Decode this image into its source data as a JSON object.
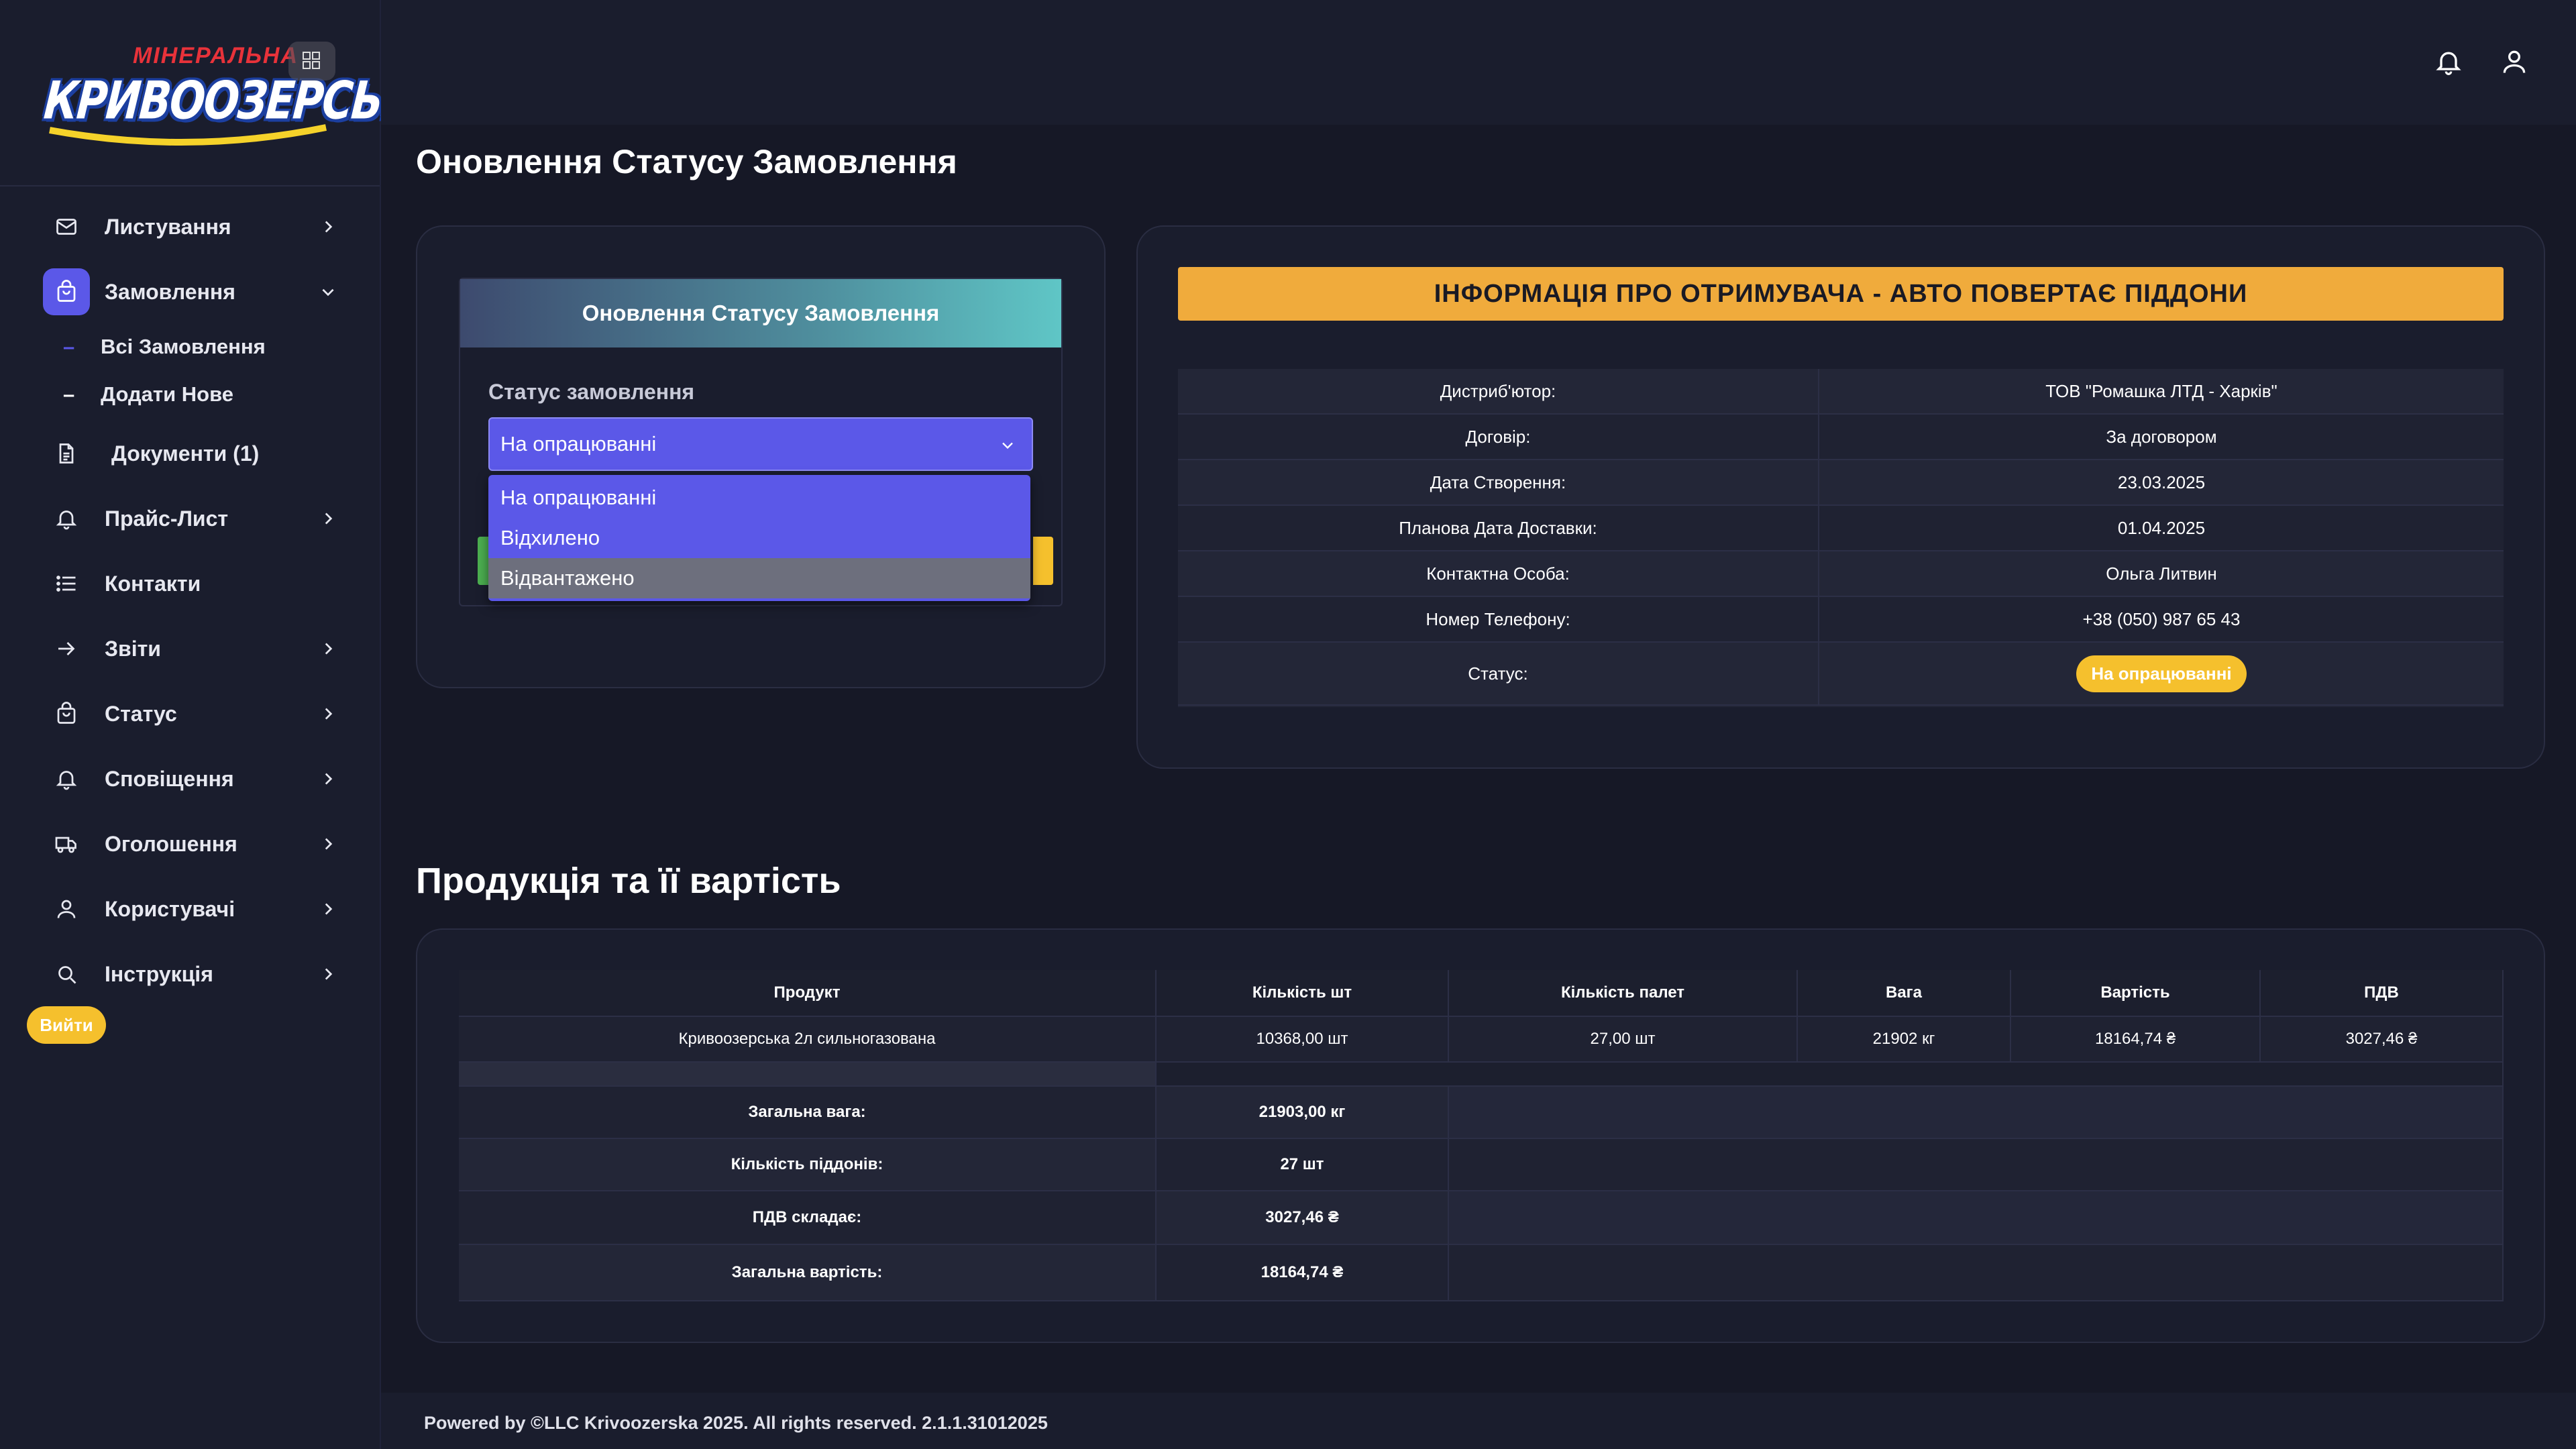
{
  "logo": {
    "top_text": "МІНЕРАЛЬНА",
    "main_text": "КРИВООЗЕРСЬКА"
  },
  "sidebar": {
    "items": [
      {
        "label": "Листування",
        "icon": "mail-icon",
        "chevron": "right"
      },
      {
        "label": "Замовлення",
        "icon": "shopping-bag-icon",
        "chevron": "down",
        "active": true
      },
      {
        "label": "Документи (1)",
        "icon": "document-icon"
      },
      {
        "label": "Прайс-Лист",
        "icon": "bell-icon",
        "chevron": "right"
      },
      {
        "label": "Контакти",
        "icon": "list-icon"
      },
      {
        "label": "Звіти",
        "icon": "arrow-right-icon",
        "chevron": "right"
      },
      {
        "label": "Статус",
        "icon": "shopping-bag-icon",
        "chevron": "right"
      },
      {
        "label": "Сповіщення",
        "icon": "bell-icon",
        "chevron": "right"
      },
      {
        "label": "Оголошення",
        "icon": "truck-icon",
        "chevron": "right"
      },
      {
        "label": "Користувачі",
        "icon": "user-icon",
        "chevron": "right"
      },
      {
        "label": "Інструкція",
        "icon": "search-icon",
        "chevron": "right"
      }
    ],
    "sub_items": [
      {
        "label": "Всі Замовлення"
      },
      {
        "label": "Додати Нове"
      }
    ],
    "logout_label": "Вийти"
  },
  "header": {
    "page_title": "Оновлення Статусу Замовлення"
  },
  "status_form": {
    "panel_title": "Оновлення Статусу Замовлення",
    "field_label": "Статус замовлення",
    "selected": "На опрацюванні",
    "options": [
      "На опрацюванні",
      "Відхилено",
      "Відвантажено"
    ],
    "hovered_option": "Відвантажено"
  },
  "recipient": {
    "banner": "ІНФОРМАЦІЯ ПРО ОТРИМУВАЧА - АВТО ПОВЕРТАЄ ПІДДОНИ",
    "rows": [
      {
        "key": "Дистриб'ютор:",
        "value": "ТОВ \"Ромашка ЛТД - Харків\""
      },
      {
        "key": "Договір:",
        "value": "За договором"
      },
      {
        "key": "Дата Створення:",
        "value": "23.03.2025"
      },
      {
        "key": "Планова Дата Доставки:",
        "value": "01.04.2025"
      },
      {
        "key": "Контактна Особа:",
        "value": "Ольга Литвин"
      },
      {
        "key": "Номер Телефону:",
        "value": "+38 (050) 987 65 43"
      },
      {
        "key": "Статус:",
        "value": "На опрацюванні"
      }
    ],
    "status_color": "#f5c02d"
  },
  "products": {
    "section_title": "Продукція та її вартість",
    "columns": [
      "Продукт",
      "Кількість шт",
      "Кількість палет",
      "Вага",
      "Вартість",
      "ПДВ"
    ],
    "rows": [
      [
        "Кривоозерська 2л сильногазована",
        "10368,00 шт",
        "27,00 шт",
        "21902 кг",
        "18164,74 ₴",
        "3027,46 ₴"
      ]
    ],
    "summary": [
      {
        "key": "Загальна вага:",
        "value": "21903,00 кг"
      },
      {
        "key": "Кількість піддонів:",
        "value": "27 шт"
      },
      {
        "key": "ПДВ складає:",
        "value": "3027,46 ₴"
      },
      {
        "key": "Загальна вартість:",
        "value": "18164,74 ₴"
      }
    ]
  },
  "footer": {
    "text": "Powered by ©LLC Krivoozerska 2025. All rights reserved. 2.1.1.31012025"
  },
  "colors": {
    "accent": "#5b58e8",
    "warning": "#f0ab3c",
    "yellow": "#f5c02d",
    "bg": "#161826",
    "panel": "#1a1d2d"
  }
}
